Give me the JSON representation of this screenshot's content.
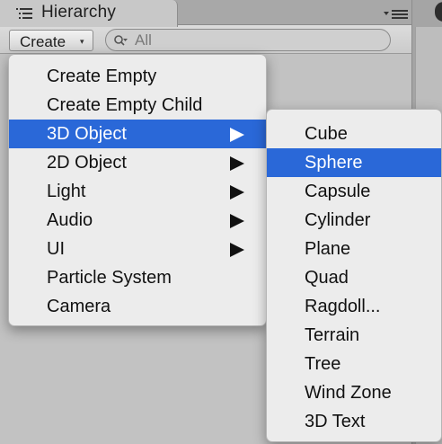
{
  "panel": {
    "tab_title": "Hierarchy",
    "tab_icon": "hierarchy-list-icon",
    "tab_menu_icon": "panel-menu-icon"
  },
  "toolbar": {
    "create_label": "Create",
    "create_caret": "▾",
    "search_placeholder": "All",
    "search_icon": "search-filter-icon"
  },
  "create_menu": {
    "items": [
      {
        "label": "Create Empty",
        "submenu": false
      },
      {
        "label": "Create Empty Child",
        "submenu": false
      },
      {
        "label": "3D Object",
        "submenu": true,
        "active": true
      },
      {
        "label": "2D Object",
        "submenu": true
      },
      {
        "label": "Light",
        "submenu": true
      },
      {
        "label": "Audio",
        "submenu": true
      },
      {
        "label": "UI",
        "submenu": true
      },
      {
        "label": "Particle System",
        "submenu": false
      },
      {
        "label": "Camera",
        "submenu": false
      }
    ]
  },
  "submenu_3d": {
    "items": [
      {
        "label": "Cube"
      },
      {
        "label": "Sphere",
        "active": true
      },
      {
        "label": "Capsule"
      },
      {
        "label": "Cylinder"
      },
      {
        "label": "Plane"
      },
      {
        "label": "Quad"
      },
      {
        "label": "Ragdoll..."
      },
      {
        "label": "Terrain"
      },
      {
        "label": "Tree"
      },
      {
        "label": "Wind Zone"
      },
      {
        "label": "3D Text"
      }
    ]
  },
  "colors": {
    "highlight": "#2a68d8",
    "menu_bg": "#ececec",
    "panel_bg": "#c2c2c2"
  }
}
